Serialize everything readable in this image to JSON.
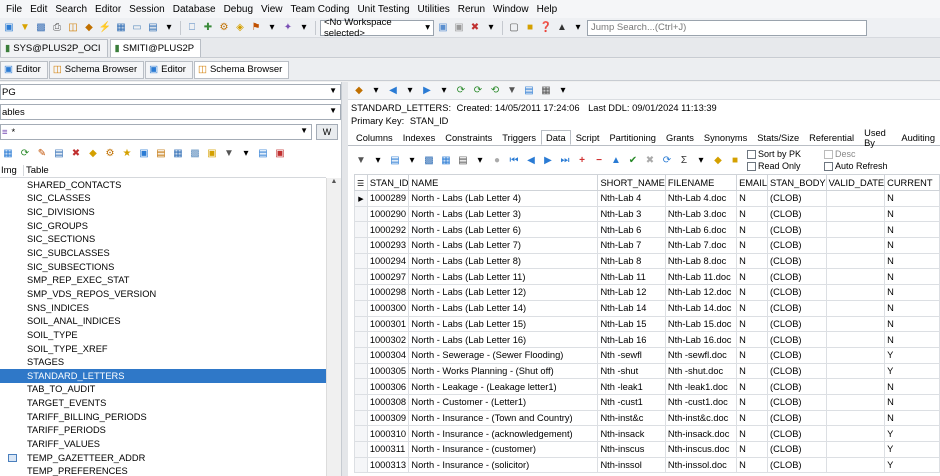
{
  "menu": [
    "File",
    "Edit",
    "Search",
    "Editor",
    "Session",
    "Database",
    "Debug",
    "View",
    "Team Coding",
    "Unit Testing",
    "Utilities",
    "Rerun",
    "Window",
    "Help"
  ],
  "toolbar": {
    "workspace_select": "<No Workspace selected>",
    "jump_search_placeholder": "Jump Search...(Ctrl+J)"
  },
  "connections": [
    {
      "label": "SYS@PLUS2P_OCI",
      "active": false
    },
    {
      "label": "SMITI@PLUS2P",
      "active": true
    }
  ],
  "view_tabs": [
    {
      "label": "Editor",
      "active": false
    },
    {
      "label": "Schema Browser",
      "active": false
    },
    {
      "label": "Editor",
      "active": false
    },
    {
      "label": "Schema Browser",
      "active": true
    }
  ],
  "left": {
    "schema_select": "PG",
    "object_type_select": "ables",
    "filter_value": "*",
    "filter_w": "W",
    "col_img": "Img",
    "col_table": "Table",
    "tables": [
      "SHARED_CONTACTS",
      "SIC_CLASSES",
      "SIC_DIVISIONS",
      "SIC_GROUPS",
      "SIC_SECTIONS",
      "SIC_SUBCLASSES",
      "SIC_SUBSECTIONS",
      "SMP_REP_EXEC_STAT",
      "SMP_VDS_REPOS_VERSION",
      "SNS_INDICES",
      "SOIL_ANAL_INDICES",
      "SOIL_TYPE",
      "SOIL_TYPE_XREF",
      "STAGES",
      "STANDARD_LETTERS",
      "TAB_TO_AUDIT",
      "TARGET_EVENTS",
      "TARIFF_BILLING_PERIODS",
      "TARIFF_PERIODS",
      "TARIFF_VALUES",
      "TEMP_GAZETTEER_ADDR",
      "TEMP_PREFERENCES"
    ],
    "selected": "STANDARD_LETTERS"
  },
  "right": {
    "table_name": "STANDARD_LETTERS:",
    "created_label": "Created:",
    "created": "14/05/2011 17:24:06",
    "ddl_label": "Last DDL:",
    "last_ddl": "09/01/2024 11:13:39",
    "pk_label": "Primary Key:",
    "pk": "STAN_ID",
    "tabs": [
      "Columns",
      "Indexes",
      "Constraints",
      "Triggers",
      "Data",
      "Script",
      "Partitioning",
      "Grants",
      "Synonyms",
      "Stats/Size",
      "Referential",
      "Used By",
      "Auditing"
    ],
    "active_tab": "Data",
    "options": {
      "sort_by_pk": "Sort by PK",
      "read_only": "Read Only",
      "desc": "Desc",
      "auto_refresh": "Auto Refresh"
    },
    "columns": [
      "STAN_ID",
      "NAME",
      "SHORT_NAME",
      "FILENAME",
      "EMAIL",
      "STAN_BODY",
      "VALID_DATE",
      "CURRENT"
    ],
    "rows": [
      [
        "1000289",
        "North - Labs (Lab Letter 4)",
        "Nth-Lab 4",
        "Nth-Lab 4.doc",
        "N",
        "(CLOB)",
        "",
        "N"
      ],
      [
        "1000290",
        "North - Labs (Lab Letter 3)",
        "Nth-Lab 3",
        "Nth-Lab 3.doc",
        "N",
        "(CLOB)",
        "",
        "N"
      ],
      [
        "1000292",
        "North - Labs (Lab Letter 6)",
        "Nth-Lab 6",
        "Nth-Lab 6.doc",
        "N",
        "(CLOB)",
        "",
        "N"
      ],
      [
        "1000293",
        "North - Labs (Lab Letter 7)",
        "Nth-Lab 7",
        "Nth-Lab 7.doc",
        "N",
        "(CLOB)",
        "",
        "N"
      ],
      [
        "1000294",
        "North - Labs (Lab Letter 8)",
        "Nth-Lab 8",
        "Nth-Lab 8.doc",
        "N",
        "(CLOB)",
        "",
        "N"
      ],
      [
        "1000297",
        "North - Labs (Lab Letter 11)",
        "Nth-Lab 11",
        "Nth-Lab 11.doc",
        "N",
        "(CLOB)",
        "",
        "N"
      ],
      [
        "1000298",
        "North - Labs (Lab Letter 12)",
        "Nth-Lab 12",
        "Nth-Lab 12.doc",
        "N",
        "(CLOB)",
        "",
        "N"
      ],
      [
        "1000300",
        "North - Labs (Lab Letter 14)",
        "Nth-Lab 14",
        "Nth-Lab 14.doc",
        "N",
        "(CLOB)",
        "",
        "N"
      ],
      [
        "1000301",
        "North - Labs (Lab Letter 15)",
        "Nth-Lab 15",
        "Nth-Lab 15.doc",
        "N",
        "(CLOB)",
        "",
        "N"
      ],
      [
        "1000302",
        "North - Labs (Lab Letter 16)",
        "Nth-Lab 16",
        "Nth-Lab 16.doc",
        "N",
        "(CLOB)",
        "",
        "N"
      ],
      [
        "1000304",
        "North - Sewerage - (Sewer Flooding)",
        "Nth -sewfl",
        "Nth -sewfl.doc",
        "N",
        "(CLOB)",
        "",
        "Y"
      ],
      [
        "1000305",
        "North - Works Planning - (Shut off)",
        "Nth -shut",
        "Nth -shut.doc",
        "N",
        "(CLOB)",
        "",
        "Y"
      ],
      [
        "1000306",
        "North - Leakage - (Leakage letter1)",
        "Nth -leak1",
        "Nth -leak1.doc",
        "N",
        "(CLOB)",
        "",
        "N"
      ],
      [
        "1000308",
        "North - Customer - (Letter1)",
        "Nth -cust1",
        "Nth -cust1.doc",
        "N",
        "(CLOB)",
        "",
        "N"
      ],
      [
        "1000309",
        "North - Insurance - (Town and Country)",
        "Nth-inst&c",
        "Nth-inst&c.doc",
        "N",
        "(CLOB)",
        "",
        "N"
      ],
      [
        "1000310",
        "North - Insurance - (acknowledgement)",
        "Nth-insack",
        "Nth-insack.doc",
        "N",
        "(CLOB)",
        "",
        "Y"
      ],
      [
        "1000311",
        "North - Insurance - (customer)",
        "Nth-inscus",
        "Nth-inscus.doc",
        "N",
        "(CLOB)",
        "",
        "Y"
      ],
      [
        "1000313",
        "North - Insurance - (solicitor)",
        "Nth-inssol",
        "Nth-inssol.doc",
        "N",
        "(CLOB)",
        "",
        "Y"
      ]
    ]
  }
}
